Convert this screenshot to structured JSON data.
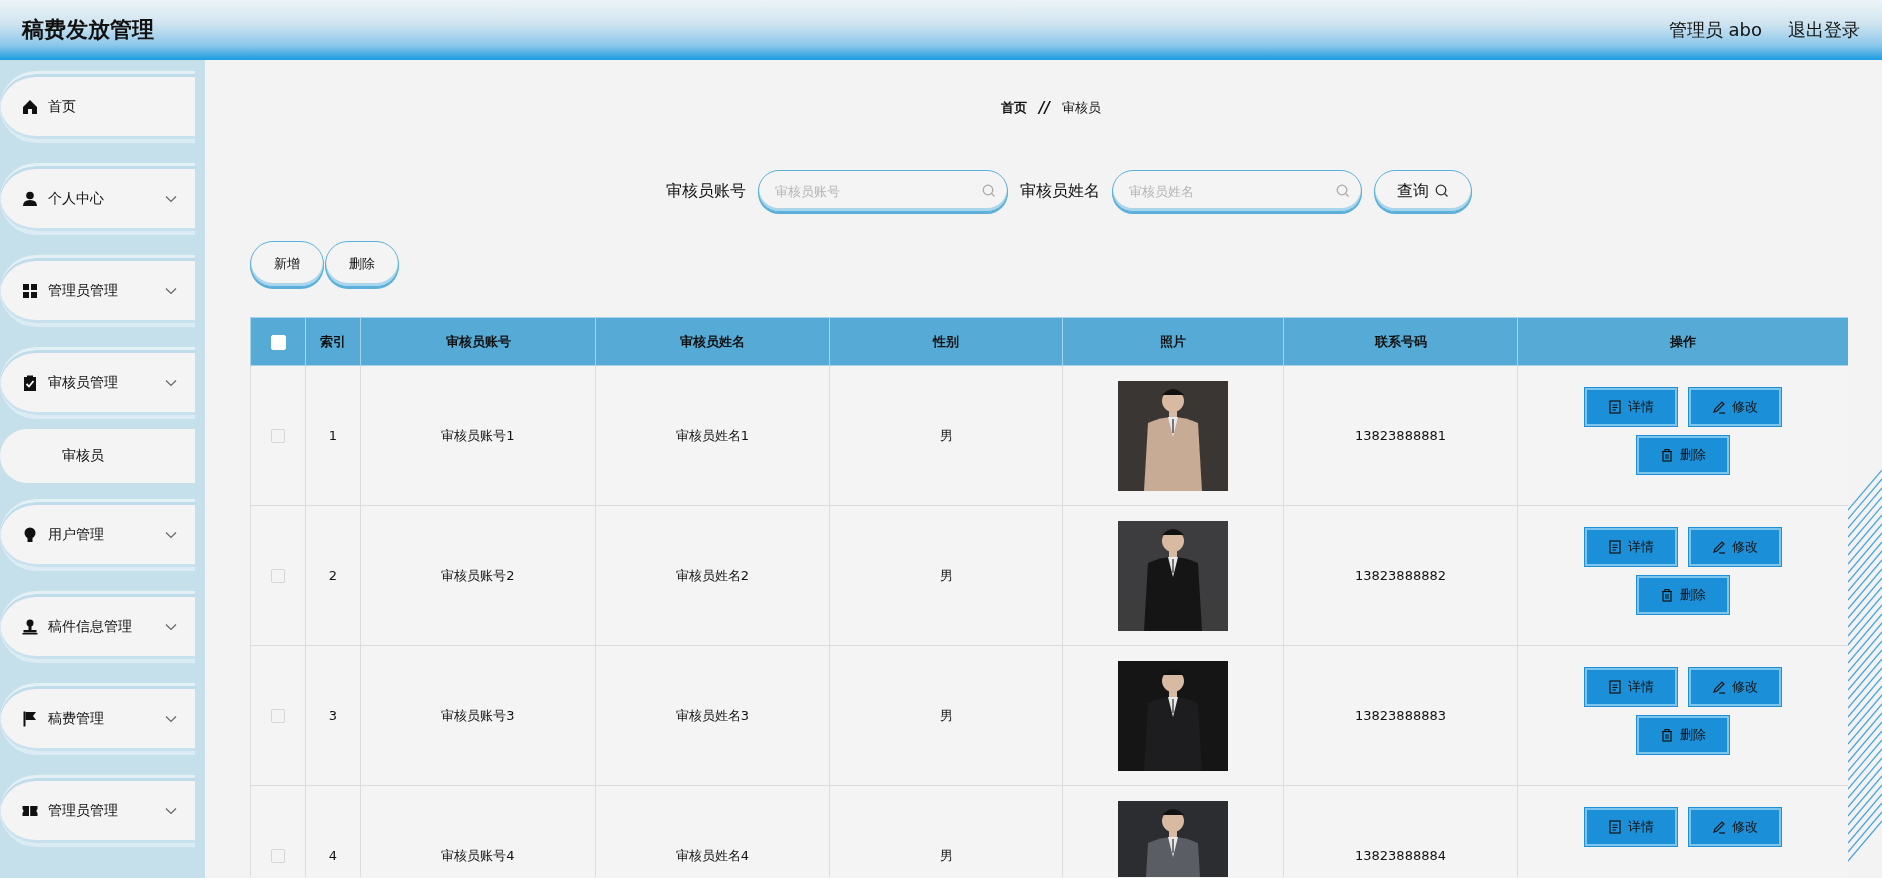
{
  "header": {
    "title": "稿费发放管理",
    "user": "管理员 abo",
    "logout": "退出登录"
  },
  "sidebar": {
    "items": [
      {
        "label": "首页",
        "kind": "link"
      },
      {
        "label": "个人中心",
        "kind": "submenu"
      },
      {
        "label": "管理员管理",
        "kind": "submenu"
      },
      {
        "label": "审核员管理",
        "kind": "submenu",
        "children": [
          {
            "label": "审核员"
          }
        ]
      },
      {
        "label": "用户管理",
        "kind": "submenu"
      },
      {
        "label": "稿件信息管理",
        "kind": "submenu"
      },
      {
        "label": "稿费管理",
        "kind": "submenu"
      },
      {
        "label": "管理员管理",
        "kind": "submenu"
      }
    ]
  },
  "breadcrumb": [
    {
      "label": "首页"
    },
    {
      "label": "审核员"
    }
  ],
  "breadcrumb_separator": "//",
  "search": {
    "fields": [
      {
        "label": "审核员账号",
        "placeholder": "审核员账号"
      },
      {
        "label": "审核员姓名",
        "placeholder": "审核员姓名"
      }
    ],
    "button": "查询"
  },
  "toolbar": [
    "新增",
    "删除"
  ],
  "table": {
    "header_checked": false,
    "columns": [
      "索引",
      "审核员账号",
      "审核员姓名",
      "性别",
      "照片",
      "联系号码",
      "操作"
    ],
    "rows": [
      {
        "checked": false,
        "index": "1",
        "account": "审核员账号1",
        "name": "审核员姓名1",
        "gender": "男",
        "photo": {
          "kind": "picture"
        },
        "phone": "13823888881",
        "actions": [
          {
            "kind": "detail",
            "label": "详情"
          },
          {
            "kind": "edit",
            "label": "修改"
          },
          {
            "kind": "delete",
            "label": "删除"
          }
        ]
      },
      {
        "checked": false,
        "index": "2",
        "account": "审核员账号2",
        "name": "审核员姓名2",
        "gender": "男",
        "photo": {
          "kind": "picture"
        },
        "phone": "13823888882",
        "actions": [
          {
            "kind": "detail",
            "label": "详情"
          },
          {
            "kind": "edit",
            "label": "修改"
          },
          {
            "kind": "delete",
            "label": "删除"
          }
        ]
      },
      {
        "checked": false,
        "index": "3",
        "account": "审核员账号3",
        "name": "审核员姓名3",
        "gender": "男",
        "photo": {
          "kind": "picture"
        },
        "phone": "13823888883",
        "actions": [
          {
            "kind": "detail",
            "label": "详情"
          },
          {
            "kind": "edit",
            "label": "修改"
          },
          {
            "kind": "delete",
            "label": "删除"
          }
        ]
      },
      {
        "checked": false,
        "index": "4",
        "account": "审核员账号4",
        "name": "审核员姓名4",
        "gender": "男",
        "photo": {
          "kind": "picture"
        },
        "phone": "13823888884",
        "actions": [
          {
            "kind": "detail",
            "label": "详情"
          },
          {
            "kind": "edit",
            "label": "修改"
          }
        ]
      }
    ]
  }
}
